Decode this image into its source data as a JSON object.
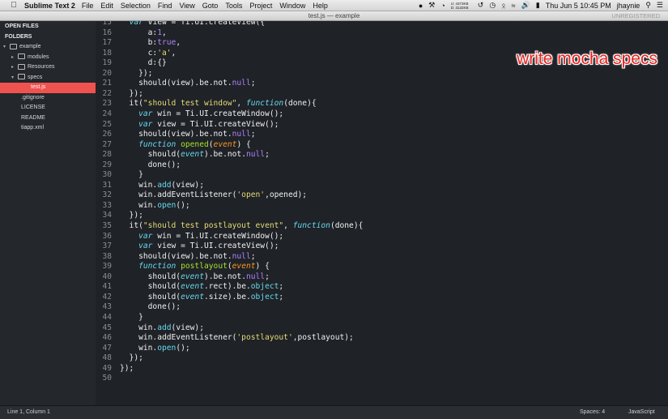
{
  "menubar": {
    "app_name": "Sublime Text 2",
    "items": [
      "File",
      "Edit",
      "Selection",
      "Find",
      "View",
      "Goto",
      "Tools",
      "Project",
      "Window",
      "Help"
    ],
    "cpu_line1": "U: 4373KB",
    "cpu_line2": "D: 3132KB",
    "datetime": "Thu Jun 5  10:45 PM",
    "user": "jhaynie"
  },
  "window": {
    "title": "test.js — example",
    "unregistered": "UNREGISTERED"
  },
  "sidebar": {
    "open_files_label": "OPEN FILES",
    "folders_label": "FOLDERS",
    "tree": [
      {
        "label": "example",
        "type": "folder",
        "expanded": true,
        "depth": 0
      },
      {
        "label": "modules",
        "type": "folder",
        "expanded": false,
        "depth": 1
      },
      {
        "label": "Resources",
        "type": "folder",
        "expanded": false,
        "depth": 1
      },
      {
        "label": "specs",
        "type": "folder",
        "expanded": true,
        "depth": 1
      },
      {
        "label": "test.js",
        "type": "file",
        "selected": true,
        "depth": 2
      },
      {
        "label": ".gitignore",
        "type": "file",
        "depth": 1
      },
      {
        "label": "LICENSE",
        "type": "file",
        "depth": 1
      },
      {
        "label": "README",
        "type": "file",
        "depth": 1
      },
      {
        "label": "tiapp.xml",
        "type": "file",
        "depth": 1
      }
    ]
  },
  "editor": {
    "overlay_text": "write mocha specs",
    "first_line_number": 15,
    "lines": [
      [
        [
          "  ",
          "t"
        ],
        [
          "var",
          "kw"
        ],
        [
          " view = Ti.UI.createView({",
          "t"
        ]
      ],
      [
        [
          "      a:",
          "t"
        ],
        [
          "1",
          "num"
        ],
        [
          ",",
          "t"
        ]
      ],
      [
        [
          "      b:",
          "t"
        ],
        [
          "true",
          "num"
        ],
        [
          ",",
          "t"
        ]
      ],
      [
        [
          "      c:",
          "t"
        ],
        [
          "'a'",
          "str"
        ],
        [
          ",",
          "t"
        ]
      ],
      [
        [
          "      d:{}",
          "t"
        ]
      ],
      [
        [
          "    });",
          "t"
        ]
      ],
      [
        [
          "    should(view).be.not.",
          "t"
        ],
        [
          "null",
          "num"
        ],
        [
          ";",
          "t"
        ]
      ],
      [
        [
          "  });",
          "t"
        ]
      ],
      [
        [
          "  it(",
          "t"
        ],
        [
          "\"should test window\"",
          "str"
        ],
        [
          ", ",
          "t"
        ],
        [
          "function",
          "kw"
        ],
        [
          "(done){",
          "t"
        ]
      ],
      [
        [
          "    ",
          "t"
        ],
        [
          "var",
          "kw"
        ],
        [
          " win = Ti.UI.createWindow();",
          "t"
        ]
      ],
      [
        [
          "    ",
          "t"
        ],
        [
          "var",
          "kw"
        ],
        [
          " view = Ti.UI.createView();",
          "t"
        ]
      ],
      [
        [
          "    should(view).be.not.",
          "t"
        ],
        [
          "null",
          "num"
        ],
        [
          ";",
          "t"
        ]
      ],
      [
        [
          "    ",
          "t"
        ],
        [
          "function",
          "kw"
        ],
        [
          " ",
          "t"
        ],
        [
          "opened",
          "fn"
        ],
        [
          "(",
          "t"
        ],
        [
          "event",
          "param"
        ],
        [
          ") {",
          "t"
        ]
      ],
      [
        [
          "      should(",
          "t"
        ],
        [
          "event",
          "ev"
        ],
        [
          ").be.not.",
          "t"
        ],
        [
          "null",
          "num"
        ],
        [
          ";",
          "t"
        ]
      ],
      [
        [
          "      done();",
          "t"
        ]
      ],
      [
        [
          "    }",
          "t"
        ]
      ],
      [
        [
          "    win.",
          "t"
        ],
        [
          "add",
          "cons"
        ],
        [
          "(view);",
          "t"
        ]
      ],
      [
        [
          "    win.addEventListener(",
          "t"
        ],
        [
          "'open'",
          "str"
        ],
        [
          ",opened);",
          "t"
        ]
      ],
      [
        [
          "    win.",
          "t"
        ],
        [
          "open",
          "cons"
        ],
        [
          "();",
          "t"
        ]
      ],
      [
        [
          "  });",
          "t"
        ]
      ],
      [
        [
          "  it(",
          "t"
        ],
        [
          "\"should test postlayout event\"",
          "str"
        ],
        [
          ", ",
          "t"
        ],
        [
          "function",
          "kw"
        ],
        [
          "(done){",
          "t"
        ]
      ],
      [
        [
          "    ",
          "t"
        ],
        [
          "var",
          "kw"
        ],
        [
          " win = Ti.UI.createWindow();",
          "t"
        ]
      ],
      [
        [
          "    ",
          "t"
        ],
        [
          "var",
          "kw"
        ],
        [
          " view = Ti.UI.createView();",
          "t"
        ]
      ],
      [
        [
          "    should(view).be.not.",
          "t"
        ],
        [
          "null",
          "num"
        ],
        [
          ";",
          "t"
        ]
      ],
      [
        [
          "    ",
          "t"
        ],
        [
          "function",
          "kw"
        ],
        [
          " ",
          "t"
        ],
        [
          "postlayout",
          "fn"
        ],
        [
          "(",
          "t"
        ],
        [
          "event",
          "param"
        ],
        [
          ") {",
          "t"
        ]
      ],
      [
        [
          "      should(",
          "t"
        ],
        [
          "event",
          "ev"
        ],
        [
          ").be.not.",
          "t"
        ],
        [
          "null",
          "num"
        ],
        [
          ";",
          "t"
        ]
      ],
      [
        [
          "      should(",
          "t"
        ],
        [
          "event",
          "ev"
        ],
        [
          ".rect).be.",
          "t"
        ],
        [
          "object",
          "cons"
        ],
        [
          ";",
          "t"
        ]
      ],
      [
        [
          "      should(",
          "t"
        ],
        [
          "event",
          "ev"
        ],
        [
          ".size).be.",
          "t"
        ],
        [
          "object",
          "cons"
        ],
        [
          ";",
          "t"
        ]
      ],
      [
        [
          "      done();",
          "t"
        ]
      ],
      [
        [
          "    }",
          "t"
        ]
      ],
      [
        [
          "    win.",
          "t"
        ],
        [
          "add",
          "cons"
        ],
        [
          "(view);",
          "t"
        ]
      ],
      [
        [
          "    win.addEventListener(",
          "t"
        ],
        [
          "'postlayout'",
          "str"
        ],
        [
          ",postlayout);",
          "t"
        ]
      ],
      [
        [
          "    win.",
          "t"
        ],
        [
          "open",
          "cons"
        ],
        [
          "();",
          "t"
        ]
      ],
      [
        [
          "  });",
          "t"
        ]
      ],
      [
        [
          "});",
          "t"
        ]
      ],
      [
        [
          "",
          "t"
        ]
      ]
    ]
  },
  "statusbar": {
    "position": "Line 1, Column 1",
    "spaces": "Spaces: 4",
    "syntax": "JavaScript"
  },
  "colors": {
    "selection": "#f0524f",
    "overlay": "#e8201c",
    "editor_bg": "#1f2227"
  }
}
